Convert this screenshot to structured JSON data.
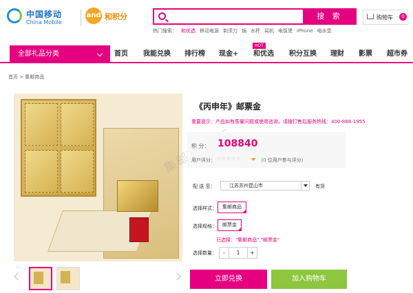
{
  "header": {
    "cm_logo_cn": "中国移动",
    "cm_logo_en": "China Mobile",
    "hjf_logo_mark": "and",
    "hjf_logo_text": "和积分",
    "search_placeholder": "",
    "search_button": "搜 索",
    "cart_label": "购物车",
    "cart_count": "0",
    "hot_label": "热门搜索：",
    "hot_terms": [
      "和优选",
      "移动电源",
      "剃须刀",
      "锅",
      "水杯",
      "耳机",
      "电饭煲",
      "iPhone",
      "电水壶"
    ]
  },
  "nav": {
    "category_label": "全部礼品分类",
    "items": [
      "首页",
      "我能兑换",
      "排行榜",
      "现金+",
      "和优选",
      "积分互换",
      "理财",
      "影票",
      "超市券"
    ],
    "hot_badge": "HOT"
  },
  "breadcrumb": "首页 > 集邮商品",
  "product": {
    "title": "《丙申年》邮票金",
    "notice": "重要提示：产品如有质量问题或使用咨询，请拨打售后服务热线：400-888-1955",
    "price_label": "积    分：",
    "price": "108840",
    "rating_label": "用户评分：",
    "stars": "☆☆☆☆☆",
    "rating_count_pre": "（",
    "rating_count": "0",
    "rating_count_post": " 位用户参与评分）",
    "ship_label": "配 送 至：",
    "ship_value": "江苏苏州昆山市",
    "stock": "有货",
    "style_label": "选择样式：",
    "style_value": "集邮商品",
    "spec_label": "选择规格：",
    "spec_value": "邮票金",
    "chosen_text": "已选择：\"集邮商品\",\"邮票金\"",
    "qty_label": "选择数量：",
    "qty_minus": "-",
    "qty_value": "1",
    "qty_plus": "+",
    "redeem_button": "立即兑换",
    "cart_button": "加入购物车"
  },
  "watermark": "集邮TAMPS"
}
